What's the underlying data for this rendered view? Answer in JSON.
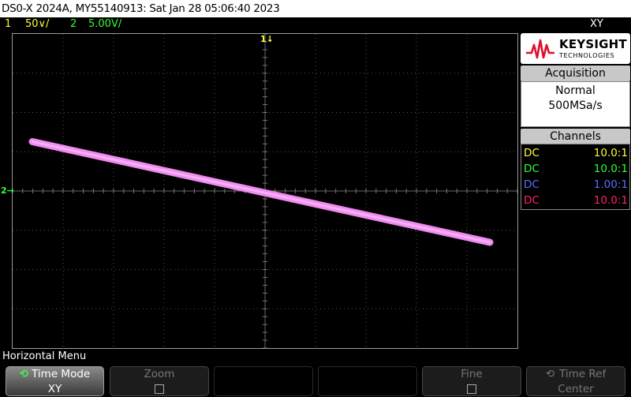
{
  "title": "DS0-X 2024A, MY55140913: Sat Jan 28 05:06:40 2023",
  "channels_bar": {
    "ch1_num": "1",
    "ch1_scale": "50∨/",
    "ch2_num": "2",
    "ch2_scale": "5.00V/",
    "mode": "XY"
  },
  "markers": {
    "top_marker": "1",
    "left_marker": "2"
  },
  "logo": {
    "brand": "KEYSIGHT",
    "sub": "TECHNOLOGIES"
  },
  "acquisition": {
    "header": "Acquisition",
    "mode": "Normal",
    "rate": "500MSa/s"
  },
  "channels_panel": {
    "header": "Channels",
    "rows": [
      {
        "coupling": "DC",
        "probe": "10.0:1",
        "color": "#ffff33"
      },
      {
        "coupling": "DC",
        "probe": "10.0:1",
        "color": "#33ff33"
      },
      {
        "coupling": "DC",
        "probe": "1.00:1",
        "color": "#5a6cff"
      },
      {
        "coupling": "DC",
        "probe": "10.0:1",
        "color": "#ff2266"
      }
    ]
  },
  "colors": {
    "ch1": "#ffff33",
    "ch2": "#33ff33",
    "trace": "#f08af0",
    "grid": "#555555"
  },
  "trace": {
    "start": [
      -29.5,
      12.5
    ],
    "end": [
      28.5,
      -13
    ]
  },
  "menu": {
    "label": "Horizontal Menu",
    "softkeys": [
      {
        "top": "Time Mode",
        "bottom": "XY"
      },
      {
        "top": "Zoom",
        "bottom": ""
      },
      {
        "top": "",
        "bottom": ""
      },
      {
        "top": "",
        "bottom": ""
      },
      {
        "top": "Fine",
        "bottom": ""
      },
      {
        "top": "Time Ref",
        "bottom": "Center"
      }
    ]
  }
}
